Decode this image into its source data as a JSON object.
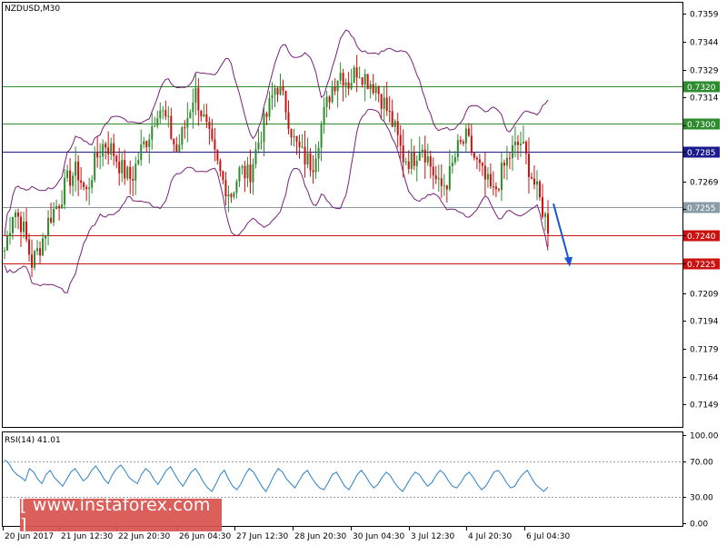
{
  "watermark": "[ www.instaforex.com ]",
  "chart_data": [
    {
      "type": "candlestick",
      "title": "NZDUSD,M30",
      "ylim": [
        0.7137,
        0.7365
      ],
      "y_ticks": [
        "0.7359",
        "0.7344",
        "0.7329",
        "0.7314",
        "0.7299",
        "0.7285",
        "0.7269",
        "0.7254",
        "0.7240",
        "0.7225",
        "0.7209",
        "0.7194",
        "0.7179",
        "0.7164",
        "0.7149"
      ],
      "x_ticks": [
        "20 Jun 2017",
        "21 Jun 12:30",
        "22 Jun 20:30",
        "26 Jun 04:30",
        "27 Jun 12:30",
        "28 Jun 20:30",
        "30 Jun 04:30",
        "3 Jul 12:30",
        "4 Jul 20:30",
        "6 Jul 04:30"
      ],
      "indicators": [
        "Bollinger Bands"
      ],
      "levels": [
        {
          "value": 0.732,
          "label": "0.7320",
          "color": "#2e8b2e"
        },
        {
          "value": 0.73,
          "label": "0.7300",
          "color": "#2e8b2e"
        },
        {
          "value": 0.7285,
          "label": "0.7285",
          "color": "#1a1a8c"
        },
        {
          "value": 0.7255,
          "label": "0.7255",
          "color": "#8a9ba8"
        },
        {
          "value": 0.724,
          "label": "0.7240",
          "color": "#cc1111"
        },
        {
          "value": 0.7225,
          "label": "0.7225",
          "color": "#cc1111"
        }
      ],
      "price_path": [
        0.7232,
        0.7255,
        0.7245,
        0.7225,
        0.7235,
        0.725,
        0.7258,
        0.727,
        0.7275,
        0.7262,
        0.728,
        0.729,
        0.7285,
        0.7275,
        0.727,
        0.7285,
        0.7295,
        0.731,
        0.73,
        0.7285,
        0.73,
        0.7318,
        0.7302,
        0.7285,
        0.727,
        0.7262,
        0.7275,
        0.7272,
        0.729,
        0.7305,
        0.7322,
        0.731,
        0.729,
        0.7282,
        0.7278,
        0.73,
        0.7318,
        0.7328,
        0.7322,
        0.733,
        0.7324,
        0.732,
        0.731,
        0.7298,
        0.7282,
        0.728,
        0.729,
        0.7278,
        0.7265,
        0.727,
        0.7286,
        0.7292,
        0.728,
        0.727,
        0.7262,
        0.7275,
        0.7285,
        0.729,
        0.7275,
        0.726,
        0.7245
      ],
      "projection": {
        "from": 0.7257,
        "to": 0.7226
      },
      "colors": {
        "up": "#2e8b2e",
        "down": "#cc1111",
        "bands": "#7a1f7a",
        "projection": "#1a55d6"
      }
    },
    {
      "type": "line",
      "title": "RSI(14) 41.01",
      "ylim": [
        0,
        100
      ],
      "y_ticks": [
        "100.00",
        "70.00",
        "30.00",
        "0.00"
      ],
      "levels": [
        70,
        30
      ],
      "values": [
        72,
        68,
        60,
        55,
        52,
        48,
        62,
        58,
        50,
        45,
        55,
        60,
        52,
        47,
        42,
        50,
        58,
        62,
        55,
        48,
        52,
        60,
        65,
        58,
        50,
        45,
        55,
        62,
        66,
        60,
        52,
        48,
        45,
        55,
        62,
        58,
        50,
        44,
        52,
        60,
        64,
        56,
        48,
        42,
        50,
        58,
        62,
        55,
        46,
        40,
        36,
        45,
        55,
        60,
        50,
        42,
        38,
        45,
        55,
        62,
        58,
        50,
        42,
        36,
        45,
        55,
        62,
        58,
        50,
        45,
        40,
        48,
        56,
        60,
        52,
        45,
        40,
        38,
        46,
        55,
        58,
        50,
        42,
        38,
        46,
        55,
        60,
        54,
        46,
        40,
        44,
        52,
        58,
        54,
        46,
        40,
        36,
        44,
        52,
        58,
        55,
        48,
        42,
        46,
        54,
        60,
        56,
        48,
        42,
        40,
        46,
        54,
        58,
        52,
        44,
        38,
        42,
        50,
        58,
        60,
        54,
        46,
        40,
        42,
        50,
        56,
        60,
        52,
        44,
        40,
        36,
        41
      ],
      "color": "#2a7fc8"
    }
  ]
}
